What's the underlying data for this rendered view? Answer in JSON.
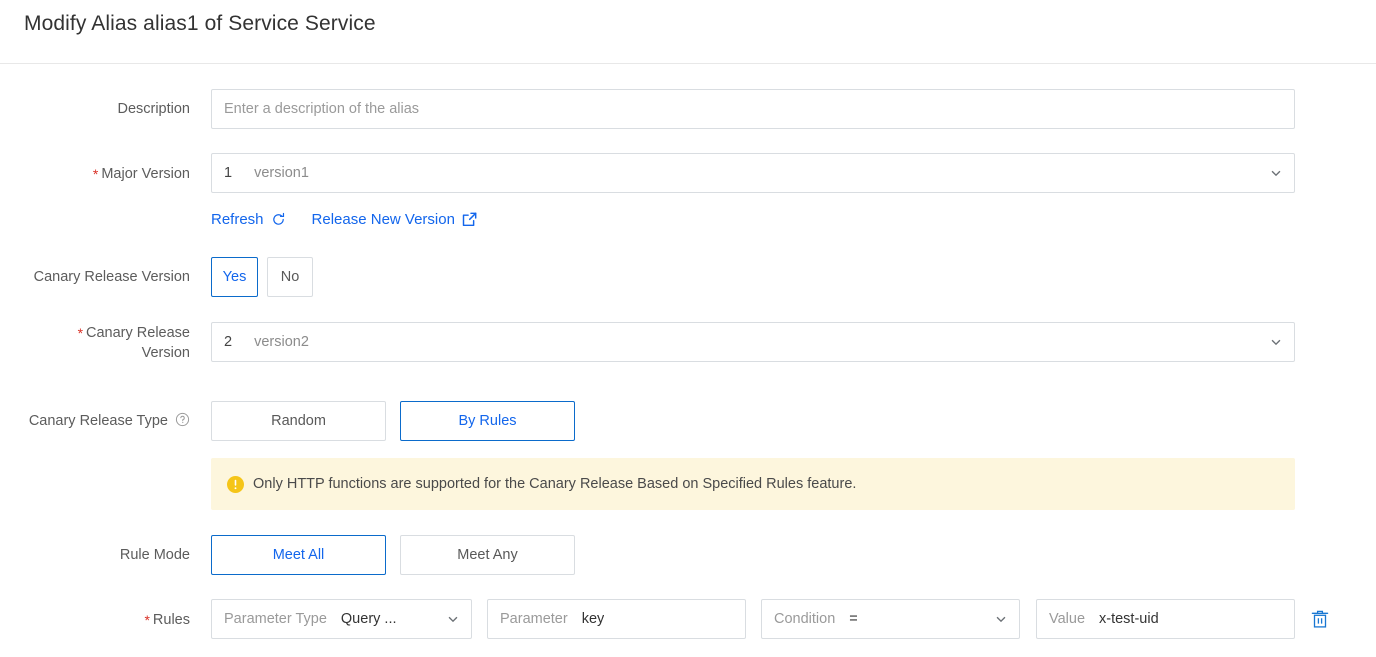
{
  "header": {
    "title": "Modify Alias alias1 of Service Service"
  },
  "form": {
    "description": {
      "label": "Description",
      "placeholder": "Enter a description of the alias",
      "value": ""
    },
    "major_version": {
      "label": "Major Version",
      "required_mark": "*",
      "number": "1",
      "name": "version1"
    },
    "version_links": {
      "refresh": "Refresh",
      "release_new_version": "Release New Version"
    },
    "canary_release_version_toggle": {
      "label": "Canary Release Version",
      "options": [
        "Yes",
        "No"
      ],
      "selected": "Yes"
    },
    "canary_release_version": {
      "label_line1": "Canary Release",
      "label_line2": "Version",
      "required_mark": "*",
      "number": "2",
      "name": "version2"
    },
    "canary_release_type": {
      "label": "Canary Release Type",
      "help_icon": "question-circle-icon",
      "options": [
        "Random",
        "By Rules"
      ],
      "selected": "By Rules"
    },
    "alert": {
      "icon": "warning-icon",
      "message": "Only HTTP functions are supported for the Canary Release Based on Specified Rules feature.",
      "bg_color": "#fdf6dd",
      "icon_color": "#f5c518"
    },
    "rule_mode": {
      "label": "Rule Mode",
      "options": [
        "Meet All",
        "Meet Any"
      ],
      "selected": "Meet All"
    },
    "rules": {
      "label": "Rules",
      "required_mark": "*",
      "rows": [
        {
          "parameter_type_label": "Parameter Type",
          "parameter_type_value": "Query ...",
          "parameter_label": "Parameter",
          "parameter_value": "key",
          "condition_label": "Condition",
          "condition_value": "=",
          "value_label": "Value",
          "value_value": "x-test-uid",
          "delete_icon": "trash-icon"
        }
      ]
    }
  },
  "theme": {
    "accent": "#1366ec",
    "selected_border": "#0b6bcb",
    "required_red": "#d93026",
    "border": "#d9dde1",
    "label_text": "#5c5c5c"
  }
}
